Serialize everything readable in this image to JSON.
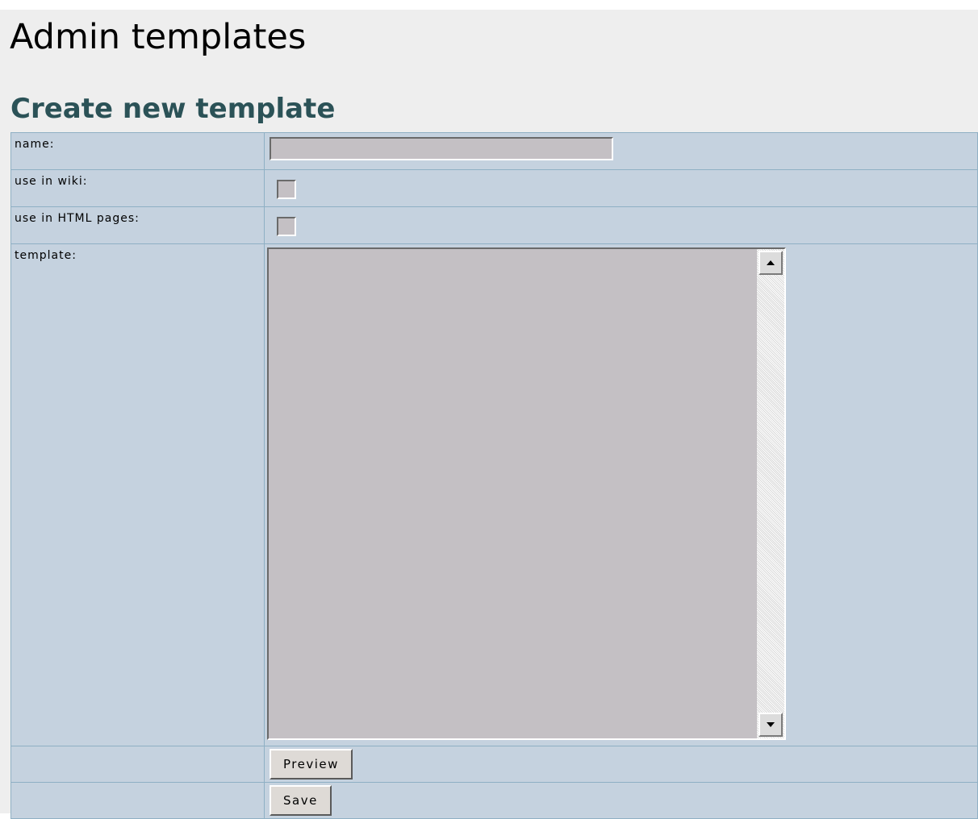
{
  "page": {
    "title": "Admin templates"
  },
  "create_form": {
    "heading": "Create new template",
    "rows": {
      "name": {
        "label": "name:",
        "value": ""
      },
      "use_in_wiki": {
        "label": "use in wiki:",
        "checked": false
      },
      "use_in_html": {
        "label": "use in HTML pages:",
        "checked": false
      },
      "template": {
        "label": "template:",
        "value": ""
      }
    },
    "buttons": {
      "preview": "Preview",
      "save": "Save"
    }
  }
}
